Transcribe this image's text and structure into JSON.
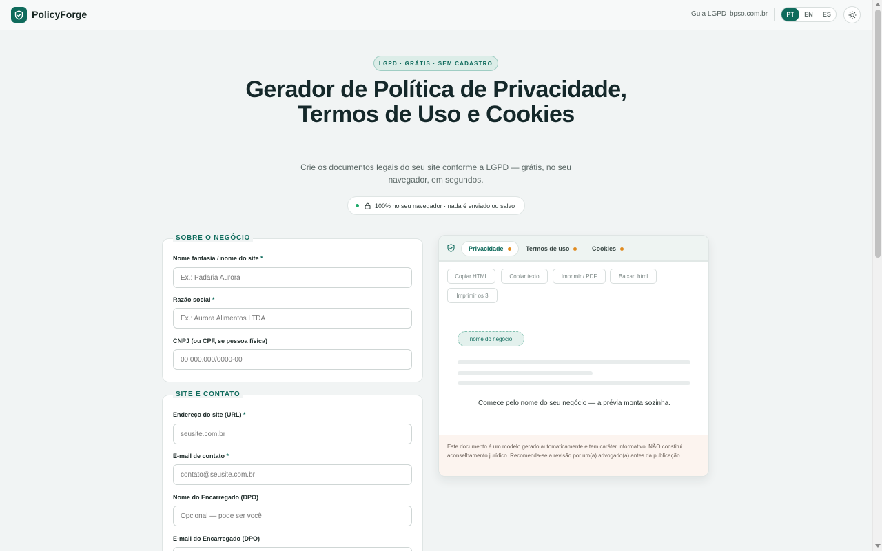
{
  "app": {
    "brand": "PolicyForge",
    "nav": {
      "guide": "Guia LGPD",
      "site": "bpso.com.br"
    },
    "languages": [
      "PT",
      "EN",
      "ES"
    ],
    "active_language": "PT",
    "accent": "#0f6b5c"
  },
  "hero": {
    "badge": "LGPD · GRÁTIS · SEM CADASTRO",
    "title": "Gerador de Política de Privacidade, Termos de Uso e Cookies",
    "subtitle": "Crie os documentos legais do seu site conforme a LGPD — grátis, no seu navegador, em segundos.",
    "privacy_note": "100% no seu navegador · nada é enviado ou salvo"
  },
  "business": {
    "legend": "SOBRE O NEGÓCIO",
    "name_label": "Nome fantasia / nome do site",
    "name_placeholder": "Ex.: Padaria Aurora",
    "legal_label": "Razão social",
    "legal_placeholder": "Ex.: Aurora Alimentos LTDA",
    "doc_label": "CNPJ (ou CPF, se pessoa física)",
    "doc_placeholder": "00.000.000/0000-00",
    "required_mark": "*"
  },
  "contact": {
    "legend": "SITE E CONTATO",
    "url_label": "Endereço do site (URL)",
    "url_placeholder": "seusite.com.br",
    "email_label": "E-mail de contato",
    "email_placeholder": "contato@seusite.com.br",
    "dpo_label": "Nome do Encarregado (DPO)",
    "dpo_placeholder": "Opcional — pode ser você",
    "dpo_email_label": "E-mail do Encarregado (DPO)",
    "required_mark": "*"
  },
  "preview": {
    "tabs": [
      "Privacidade",
      "Termos de uso",
      "Cookies"
    ],
    "active_tab": "Privacidade",
    "tools": [
      "Copiar HTML",
      "Copiar texto",
      "Imprimir / PDF",
      "Baixar .html",
      "Imprimir os 3"
    ],
    "chip": "[nome do negócio]",
    "hint": "Comece pelo nome do seu negócio — a prévia monta sozinha.",
    "disclaimer": "Este documento é um modelo gerado automaticamente e tem caráter informativo. NÃO constitui aconselhamento jurídico. Recomenda-se a revisão por um(a) advogado(a) antes da publicação."
  }
}
